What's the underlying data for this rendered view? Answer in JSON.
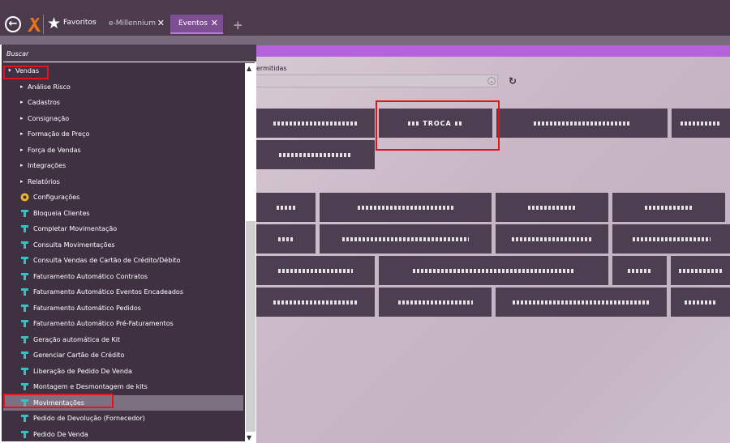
{
  "topbar": {
    "favorites_label": "Favoritos",
    "favorites_caret": "⌄",
    "tabs": [
      {
        "label": "e-Millennium",
        "close": "✕"
      },
      {
        "label": "Eventos",
        "close": "✕"
      }
    ],
    "add_tab": "+"
  },
  "search": {
    "placeholder": "Buscar"
  },
  "menu": {
    "items": [
      {
        "label": "Vendas",
        "arrow": "▾"
      },
      {
        "label": "Análise Risco",
        "arrow": "▸"
      },
      {
        "label": "Cadastros",
        "arrow": "▸"
      },
      {
        "label": "Consignação",
        "arrow": "▸"
      },
      {
        "label": "Formação de Preço",
        "arrow": "▸"
      },
      {
        "label": "Força de Vendas",
        "arrow": "▸"
      },
      {
        "label": "Integrações",
        "arrow": "▸"
      },
      {
        "label": "Relatórios",
        "arrow": "▸"
      },
      {
        "label": "Configurações",
        "icon": "settings-icon"
      },
      {
        "label": "Bloqueia Clientes",
        "icon": "hammer-icon"
      },
      {
        "label": "Completar Movimentação",
        "icon": "hammer-icon"
      },
      {
        "label": "Consulta Movimentações",
        "icon": "hammer-icon"
      },
      {
        "label": "Consulta Vendas de Cartão de Crédito/Débito",
        "icon": "hammer-icon"
      },
      {
        "label": "Faturamento Automático Contratos",
        "icon": "hammer-icon"
      },
      {
        "label": "Faturamento Automático Eventos Encadeados",
        "icon": "hammer-icon"
      },
      {
        "label": "Faturamento Automático Pedidos",
        "icon": "hammer-icon"
      },
      {
        "label": "Faturamento Automático Pré-Faturamentos",
        "icon": "hammer-icon"
      },
      {
        "label": "Geração automática de Kit",
        "icon": "hammer-icon"
      },
      {
        "label": "Gerenciar Cartão de Crédito",
        "icon": "hammer-icon"
      },
      {
        "label": "Liberação de Pedido De Venda",
        "icon": "hammer-icon"
      },
      {
        "label": "Montagem e Desmontagem de kits",
        "icon": "hammer-icon"
      },
      {
        "label": "Movimentações",
        "icon": "hammer-icon"
      },
      {
        "label": "Pedido de Devolução (Fornecedor)",
        "icon": "hammer-icon"
      },
      {
        "label": "Pedido De Venda",
        "icon": "hammer-icon"
      }
    ]
  },
  "content": {
    "permitted_label": "ermitidas",
    "select_caret": "⌄",
    "refresh_glyph": "↻",
    "event_button_visible_label": "TROCA",
    "selected_menu_item": "Movimentações"
  },
  "colors": {
    "accent_purple": "#b463dd",
    "tab_active": "#7d4e92",
    "topbar": "#4b3b4c",
    "button": "#4e3e52",
    "highlight_red": "#e0161e"
  }
}
